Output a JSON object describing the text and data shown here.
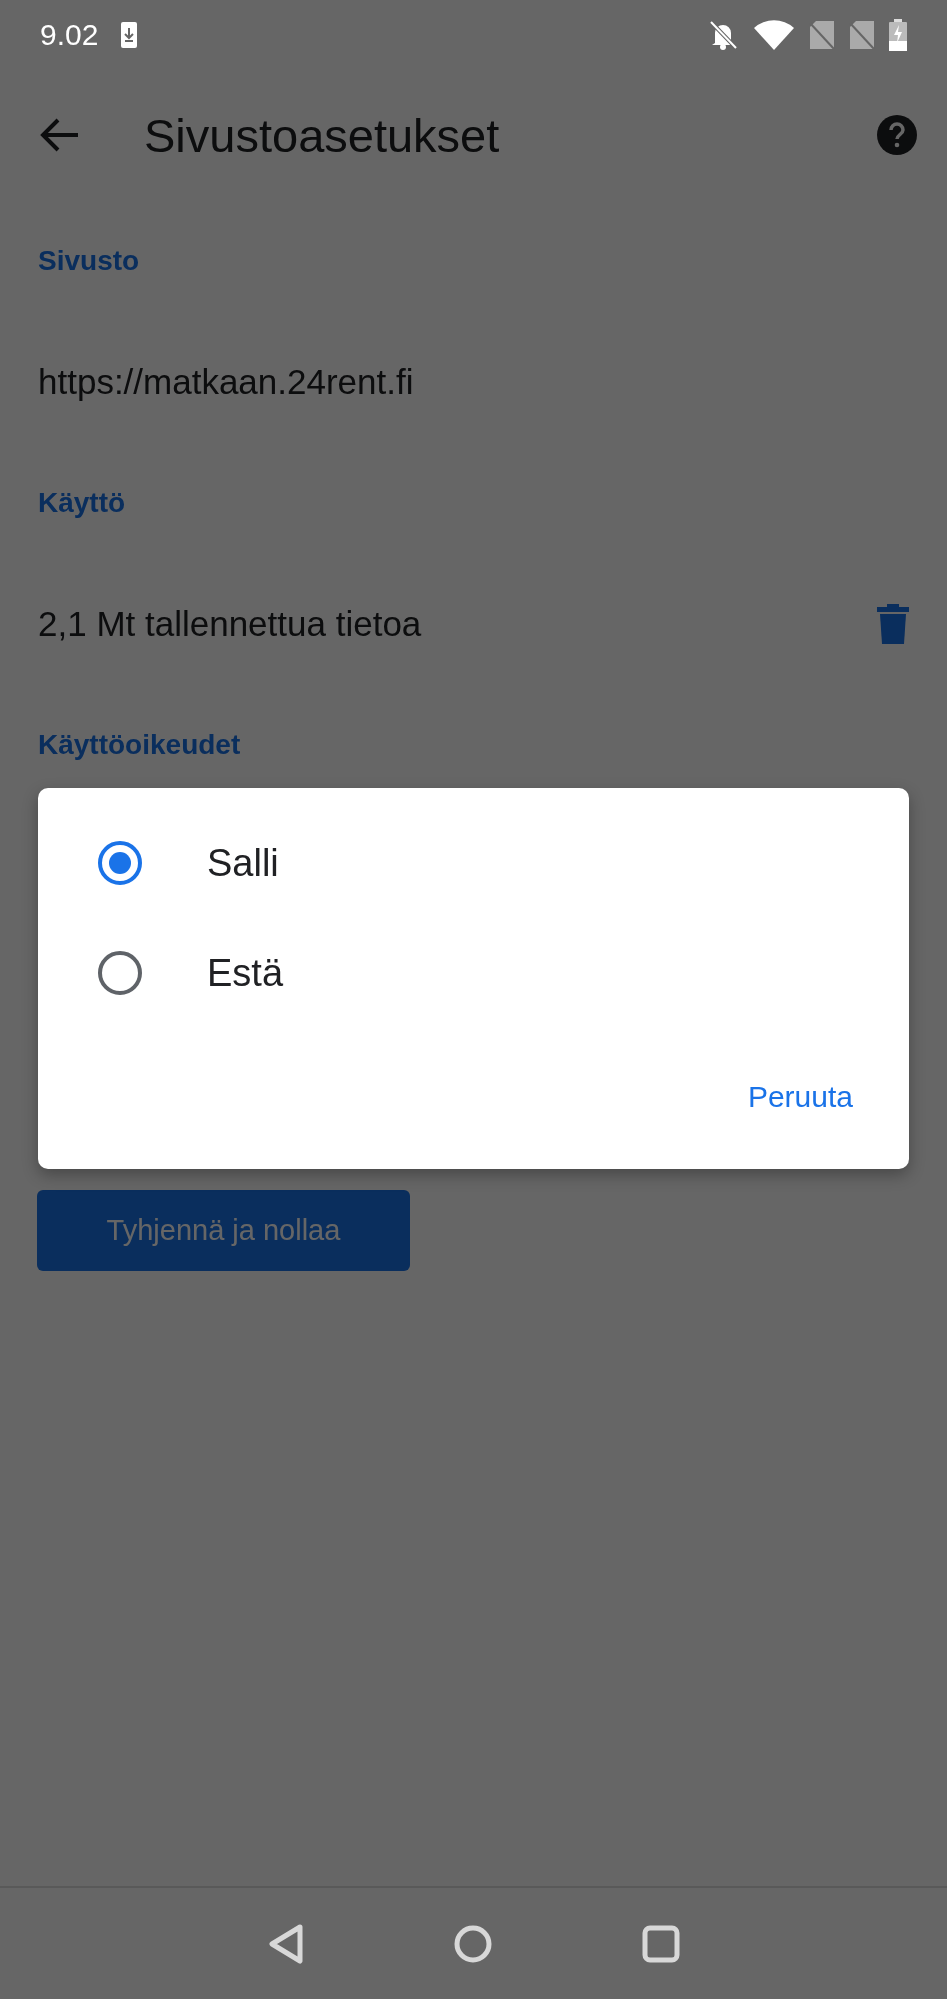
{
  "status_bar": {
    "time": "9.02"
  },
  "toolbar": {
    "title": "Sivustoasetukset"
  },
  "sections": [
    {
      "header": "Sivusto",
      "rows": [
        {
          "kind": "text",
          "text": "https://matkaan.24rent.fi"
        }
      ]
    },
    {
      "header": "Käyttö",
      "rows": [
        {
          "kind": "storage",
          "text": "2,1 Mt tallennettua tietoa"
        }
      ]
    },
    {
      "header": "Käyttöoikeudet"
    }
  ],
  "reset_button": {
    "label": "Tyhjennä ja nollaa"
  },
  "dialog": {
    "options": [
      {
        "label": "Salli",
        "selected": true
      },
      {
        "label": "Estä",
        "selected": false
      }
    ],
    "cancel": "Peruuta"
  }
}
